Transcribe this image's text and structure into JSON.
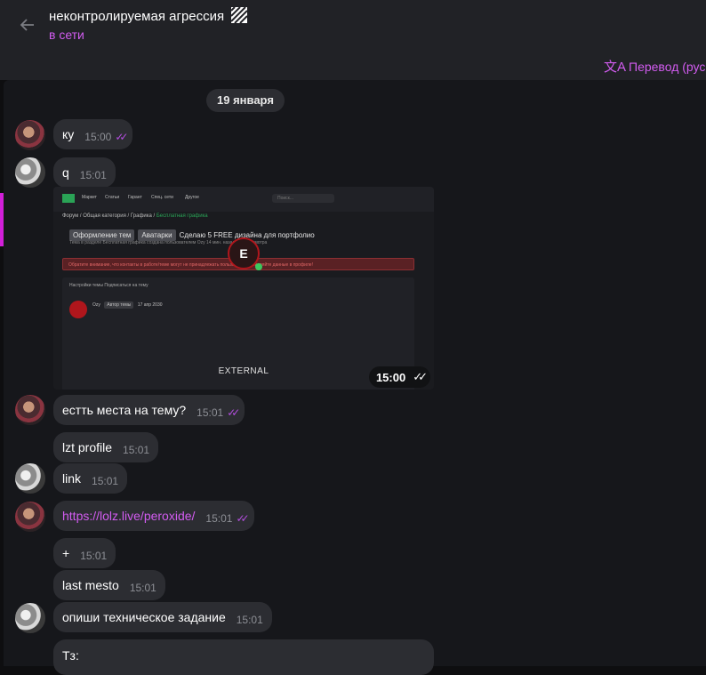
{
  "header": {
    "back_icon": "arrow-left-icon",
    "title": "неконтролируемая агрессия",
    "status": "в сети",
    "translate_icon": "translate-icon",
    "translate_label": "Перевод (русск"
  },
  "date_separator": "19 января",
  "messages": [
    {
      "text": "ку",
      "time": "15:00",
      "read": "✓✓"
    },
    {
      "text": "q",
      "time": "15:01"
    },
    {
      "text": "естть места на тему?",
      "time": "15:01",
      "read": "✓✓"
    },
    {
      "text": "lzt profile",
      "time": "15:01"
    },
    {
      "text": "link",
      "time": "15:01"
    },
    {
      "text": "https://lolz.live/peroxide/",
      "time": "15:01",
      "read": "✓✓"
    },
    {
      "text": "+",
      "time": "15:01"
    },
    {
      "text": "last mesto",
      "time": "15:01"
    },
    {
      "text": "опиши техническое задание",
      "time": "15:01"
    },
    {
      "text": "Тз:"
    }
  ],
  "photo": {
    "time": "15:00",
    "read": "✓✓",
    "nav": [
      "Маркет",
      "Статьи",
      "Гарант",
      "Спец. сети",
      "Другое"
    ],
    "search_placeholder": "Поиск...",
    "breadcrumb": [
      "Форум",
      "Общая категория",
      "Графика",
      "Бесплатная графика"
    ],
    "tags": [
      "Оформление тем",
      "Аватарки"
    ],
    "thread_title": "Сделаю 5 FREE дизайна для портфолио",
    "meta": "Тема в разделе Бесплатная графика создана пользователем Ozy 14 мин. назад · 32 просмотра",
    "warning": "Обратите внимание, что контакты в работе/теме могут не принадлежать пользователю. Сверяйте данные в профиле!",
    "post_header": "Настройки темы  Подписаться на тему",
    "author": "Ozy",
    "author_badge": "Автор темы",
    "post_date": "17 апр 2030",
    "center_logo": "E",
    "external_label": "EXTERNAL"
  },
  "colors": {
    "accent": "#d25cf0",
    "bubble": "#2c2d32",
    "background": "#16171b",
    "header": "#212226"
  }
}
